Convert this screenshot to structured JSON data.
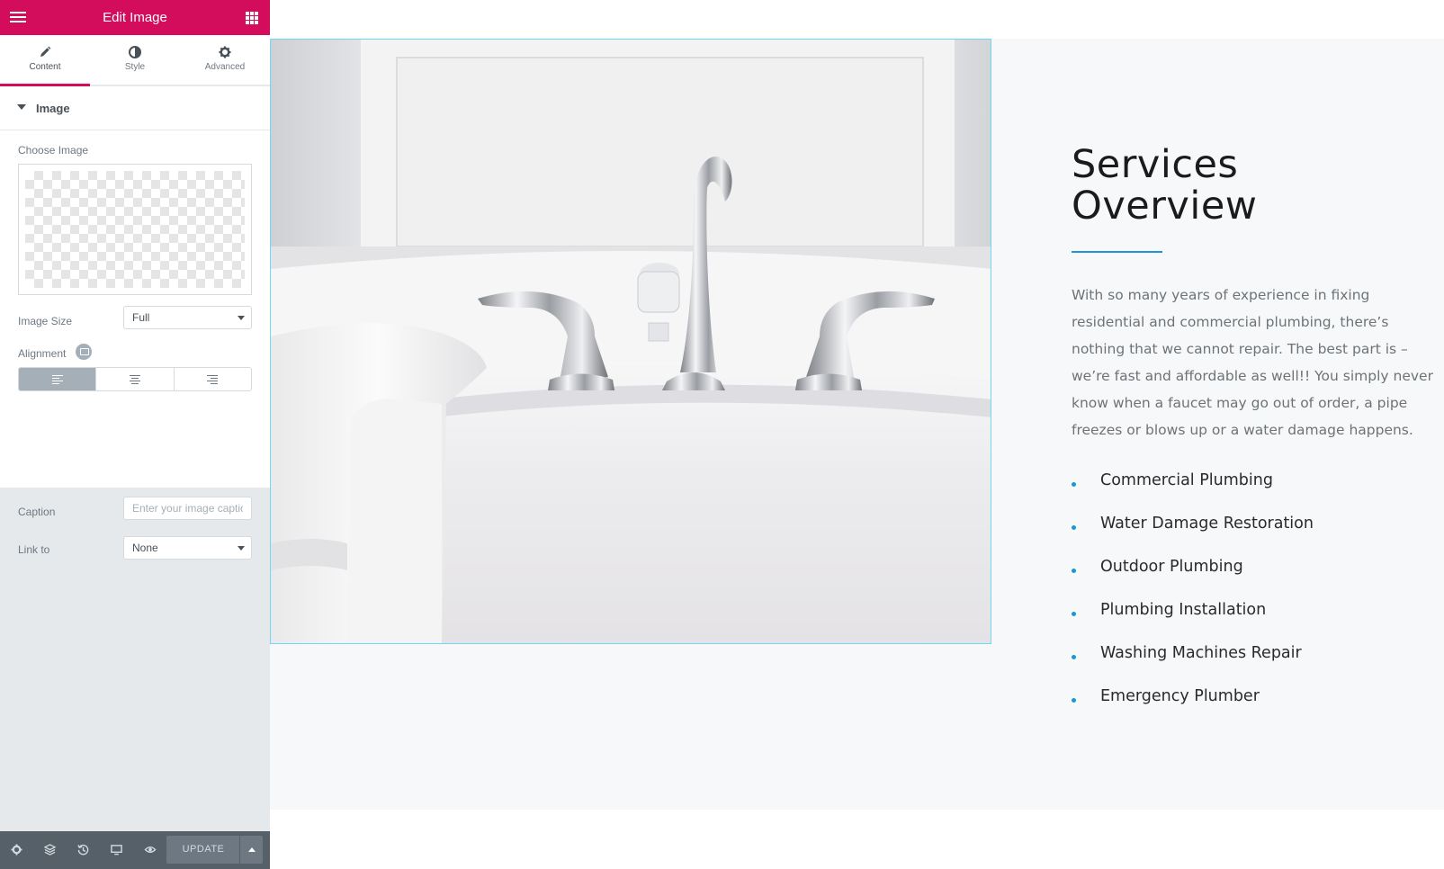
{
  "panel": {
    "title": "Edit Image",
    "tabs": [
      {
        "label": "Content",
        "icon": "pencil-icon",
        "active": true
      },
      {
        "label": "Style",
        "icon": "half-circle-icon",
        "active": false
      },
      {
        "label": "Advanced",
        "icon": "gear-icon",
        "active": false
      }
    ],
    "section": {
      "title": "Image"
    },
    "controls": {
      "choose_image_label": "Choose Image",
      "image_size_label": "Image Size",
      "image_size_value": "Full",
      "alignment_label": "Alignment",
      "alignment_value": "left",
      "caption_label": "Caption",
      "caption_placeholder": "Enter your image caption",
      "link_to_label": "Link to",
      "link_to_value": "None"
    },
    "footer": {
      "icons": [
        "settings-icon",
        "navigator-icon",
        "history-icon",
        "responsive-icon",
        "preview-icon"
      ],
      "update_label": "UPDATE"
    }
  },
  "preview": {
    "image_alt": "Bathtub with chrome faucet and white towel",
    "services": {
      "title_line1": "Services",
      "title_line2": "Overview",
      "paragraph": "With so many years of experience in fixing residential and commercial plumbing, there’s nothing that we cannot repair. The best part is – we’re fast and affordable as well!! You simply never know when a faucet may go out of order, a pipe freezes or blows up or a water damage happens.",
      "items": [
        "Commercial Plumbing",
        "Water Damage Restoration",
        "Outdoor Plumbing",
        "Plumbing Installation",
        "Washing Machines Repair",
        "Emergency Plumber"
      ]
    }
  },
  "colors": {
    "brand": "#d30c5c",
    "accent": "#1e96d4",
    "panel_bg": "#e6e9ec",
    "footer_bg": "#556068"
  }
}
